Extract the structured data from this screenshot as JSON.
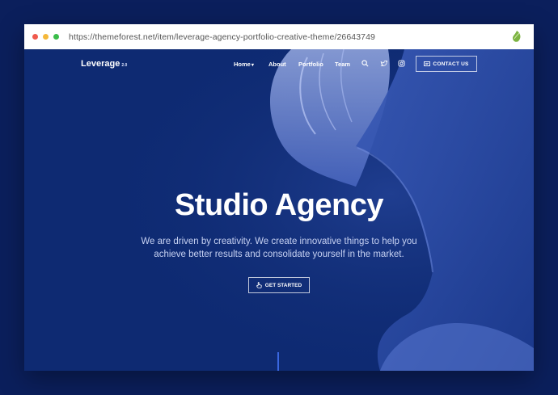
{
  "browser": {
    "url": "https://themeforest.net/item/leverage-agency-portfolio-creative-theme/26643749",
    "icons": [
      "close-dot",
      "minimize-dot",
      "maximize-dot",
      "envato-leaf-icon"
    ]
  },
  "nav": {
    "logo": "Leverage",
    "logo_version": "2.0",
    "links": [
      "Home",
      "About",
      "Portfolio",
      "Team"
    ],
    "contact_label": "CONTACT US",
    "icons": [
      "search-icon",
      "twitter-icon",
      "instagram-icon",
      "chevron-down-icon"
    ]
  },
  "hero": {
    "title": "Studio Agency",
    "subtitle": "We are driven by creativity. We create innovative things to help you achieve better results and consolidate yourself in the market.",
    "cta_label": "GET STARTED",
    "cta_icon": "hand-pointer-icon"
  },
  "colors": {
    "outer_bg": "#0b1f5c",
    "page_bg": "#0e2a72",
    "accent": "#3a67e0",
    "text": "#ffffff"
  }
}
